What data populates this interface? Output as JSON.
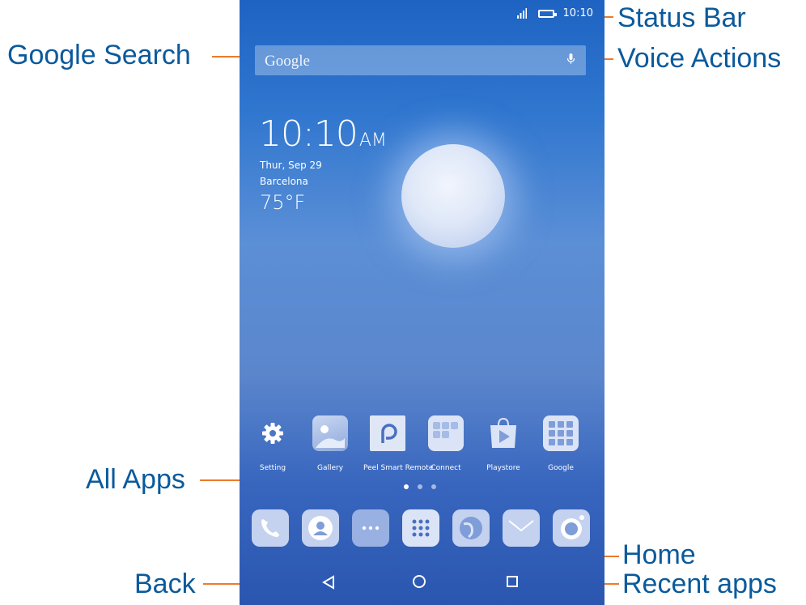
{
  "callouts": {
    "google_search": "Google Search",
    "status_bar": "Status Bar",
    "voice_actions": "Voice Actions",
    "all_apps": "All Apps",
    "home": "Home",
    "back": "Back",
    "recent_apps": "Recent apps"
  },
  "status_bar": {
    "time": "10:10",
    "icons": [
      "signal-icon",
      "battery-icon"
    ]
  },
  "search": {
    "text": "Google",
    "icon": "mic-icon"
  },
  "clock": {
    "time": "10:10",
    "ampm": "AM",
    "date": "Thur, Sep 29",
    "city": "Barcelona",
    "temperature": "75°F"
  },
  "apps": [
    {
      "label": "Setting",
      "icon": "gear-icon"
    },
    {
      "label": "Gallery",
      "icon": "gallery-icon"
    },
    {
      "label": "Peel Smart Remote",
      "icon": "peel-icon"
    },
    {
      "label": "Connect",
      "icon": "connect-icon"
    },
    {
      "label": "Playstore",
      "icon": "playstore-icon"
    },
    {
      "label": "Google",
      "icon": "google-folder-icon"
    }
  ],
  "page_indicator": {
    "count": 3,
    "active": 1
  },
  "dock": [
    "phone-icon",
    "contacts-icon",
    "messages-icon",
    "all-apps-icon",
    "browser-icon",
    "email-icon",
    "camera-icon"
  ],
  "nav": [
    "back-button",
    "home-button",
    "recent-apps-button"
  ],
  "colors": {
    "callout_text": "#0a5a9c",
    "callout_line": "#ec7a2c"
  }
}
